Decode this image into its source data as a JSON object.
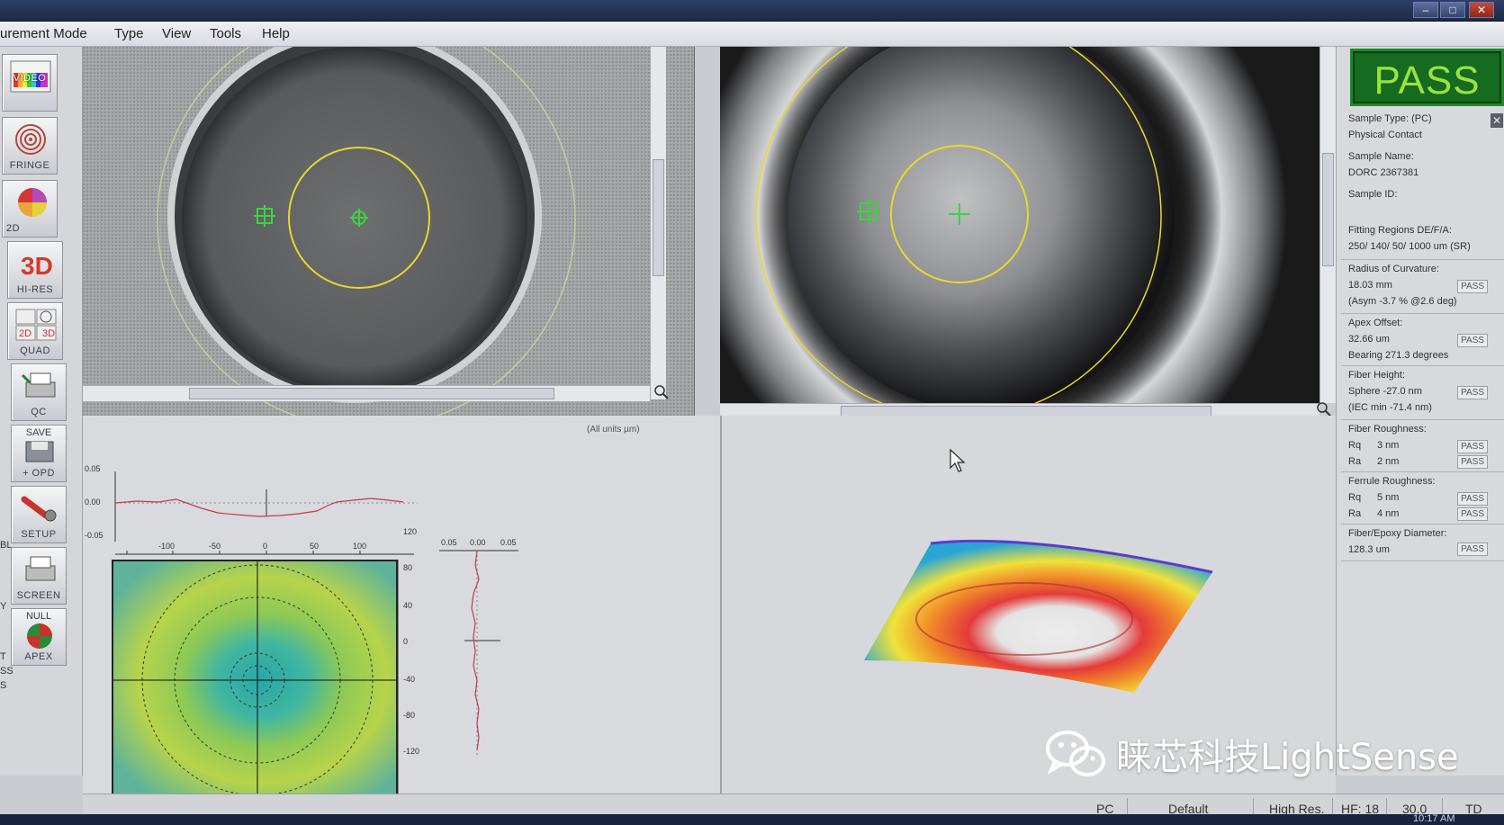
{
  "window": {
    "title": "",
    "min_label": "–",
    "max_label": "□",
    "close_label": "✕"
  },
  "menu": {
    "items": [
      "urement Mode",
      "Type",
      "View",
      "Tools",
      "Help"
    ]
  },
  "toolbar": {
    "video": "VIDEO",
    "fringe": "FRINGE",
    "twod": "2D",
    "hires": "HI-RES",
    "quad": "QUAD",
    "quad_2d": "2D",
    "quad_3d": "3D",
    "qc": "QC",
    "save_top": "SAVE",
    "save_bottom": "+ OPD",
    "setup": "SETUP",
    "screen": "SCREEN",
    "null_top": "NULL",
    "null_bottom": "APEX",
    "edge_left": [
      "Y",
      "T",
      "SS",
      "S",
      "BL"
    ]
  },
  "profile_plot": {
    "units_label": "(All units µm)",
    "top_yticks": [
      "0.05",
      "0.00",
      "-0.05"
    ],
    "xticks": [
      "-100",
      "-50",
      "0",
      "50",
      "100"
    ],
    "side_xticks": [
      "0.05",
      "0.00",
      "0.05"
    ],
    "side_yticks": [
      "120",
      "80",
      "40",
      "0",
      "-40",
      "-80",
      "-120"
    ]
  },
  "results": {
    "status": "PASS",
    "sample_type_label": "Sample Type: (PC)",
    "sample_type_value": "Physical Contact",
    "sample_name_label": "Sample Name:",
    "sample_name_value": "DORC 2367381",
    "sample_id_label": "Sample ID:",
    "fitting_label": "Fitting Regions DE/F/A:",
    "fitting_value": "250/ 140/ 50/ 1000 um  (SR)",
    "roc_label": "Radius of Curvature:",
    "roc_value": "18.03 mm",
    "roc_asym": "(Asym -3.7 % @2.6 deg)",
    "roc_result": "PASS",
    "apex_label": "Apex Offset:",
    "apex_value": "32.66 um",
    "apex_bearing": "Bearing 271.3 degrees",
    "apex_result": "PASS",
    "fiber_height_label": "Fiber Height:",
    "fiber_height_value": "Sphere  -27.0 nm",
    "fiber_height_iec": "(IEC min  -71.4 nm)",
    "fiber_height_result": "PASS",
    "fiber_rough_label": "Fiber Roughness:",
    "fiber_rq_label": "Rq",
    "fiber_rq": "3 nm",
    "fiber_rq_result": "PASS",
    "fiber_ra_label": "Ra",
    "fiber_ra": "2 nm",
    "fiber_ra_result": "PASS",
    "ferrule_rough_label": "Ferrule Roughness:",
    "ferrule_rq_label": "Rq",
    "ferrule_rq": "5 nm",
    "ferrule_rq_result": "PASS",
    "ferrule_ra_label": "Ra",
    "ferrule_ra": "4 nm",
    "ferrule_ra_result": "PASS",
    "epoxy_label": "Fiber/Epoxy Diameter:",
    "epoxy_value": "128.3 um",
    "epoxy_result": "PASS"
  },
  "statusbar": {
    "mode": "PC",
    "profile": "Default",
    "resolution": "High Res.",
    "hf": "HF: 18",
    "value": "30.0",
    "td": "TD"
  },
  "taskbar": {
    "clock": "10:17 AM"
  },
  "watermark": {
    "text": "睐芯科技LightSense",
    "icon": "wechat-icon"
  },
  "colors": {
    "pass_green": "#156b1f",
    "pass_text": "#9be23e",
    "overlay_yellow": "#e8d82c",
    "marker_green": "#3fd23f"
  }
}
